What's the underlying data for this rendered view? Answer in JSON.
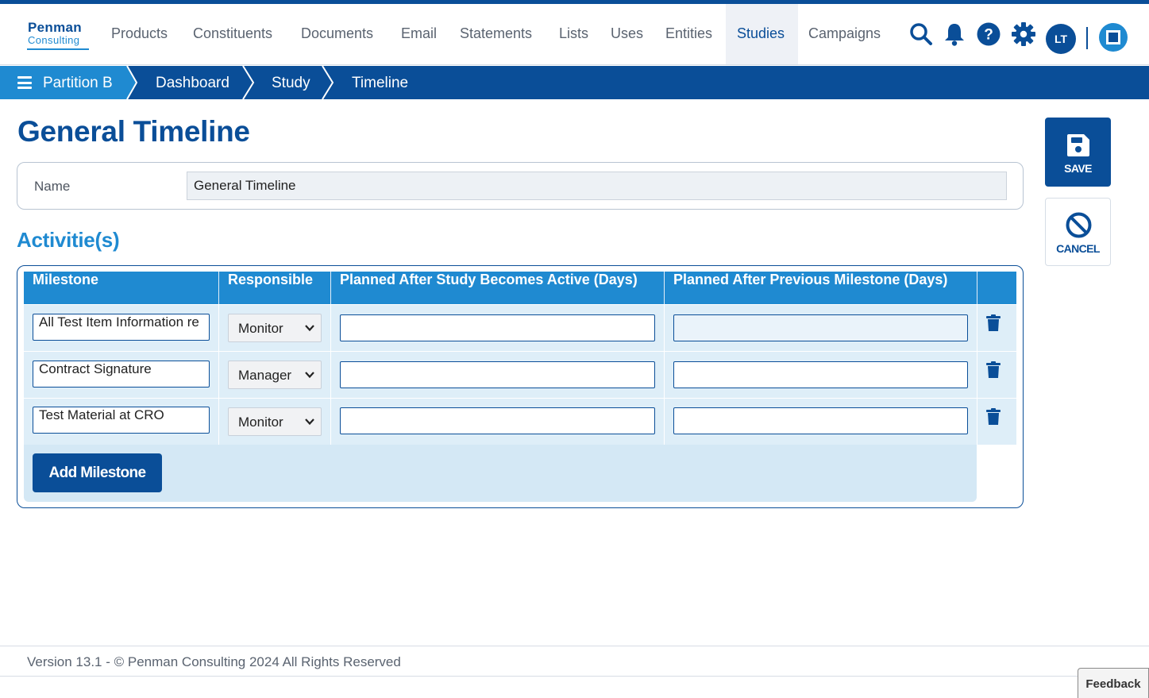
{
  "brand": {
    "line1": "Penman",
    "line2": "Consulting"
  },
  "nav": {
    "items": [
      {
        "label": "Products"
      },
      {
        "label": "Constituents"
      },
      {
        "label": "Documents"
      },
      {
        "label": "Email"
      },
      {
        "label": "Statements"
      },
      {
        "label": "Lists"
      },
      {
        "label": "Uses"
      },
      {
        "label": "Entities"
      },
      {
        "label": "Studies",
        "active": true
      },
      {
        "label": "Campaigns"
      }
    ],
    "user_initials": "LT",
    "icons": [
      "search-icon",
      "bell-icon",
      "help-icon",
      "gear-icon"
    ]
  },
  "breadcrumb": {
    "partition": "Partition B",
    "items": [
      "Dashboard",
      "Study",
      "Timeline"
    ]
  },
  "page": {
    "title": "General Timeline",
    "name_label": "Name",
    "name_value": "General Timeline",
    "section_title": "Activitie(s)"
  },
  "table": {
    "columns": [
      "Milestone",
      "Responsible",
      "Planned After Study Becomes Active (Days)",
      "Planned After Previous Milestone (Days)"
    ],
    "rows": [
      {
        "milestone": "All Test Item Information re",
        "responsible": "Monitor",
        "days_after_active": "",
        "days_after_previous": ""
      },
      {
        "milestone": "Contract Signature",
        "responsible": "Manager",
        "days_after_active": "",
        "days_after_previous": ""
      },
      {
        "milestone": "Test Material at CRO",
        "responsible": "Monitor",
        "days_after_active": "",
        "days_after_previous": ""
      }
    ],
    "add_label": "Add Milestone"
  },
  "actions": {
    "save": "SAVE",
    "cancel": "CANCEL"
  },
  "footer": {
    "text": "Version 13.1 - © Penman Consulting 2024 All Rights Reserved"
  },
  "feedback": "Feedback",
  "colors": {
    "primary": "#0a4e98",
    "accent": "#1f8ad1",
    "row_bg": "#deeef8"
  }
}
